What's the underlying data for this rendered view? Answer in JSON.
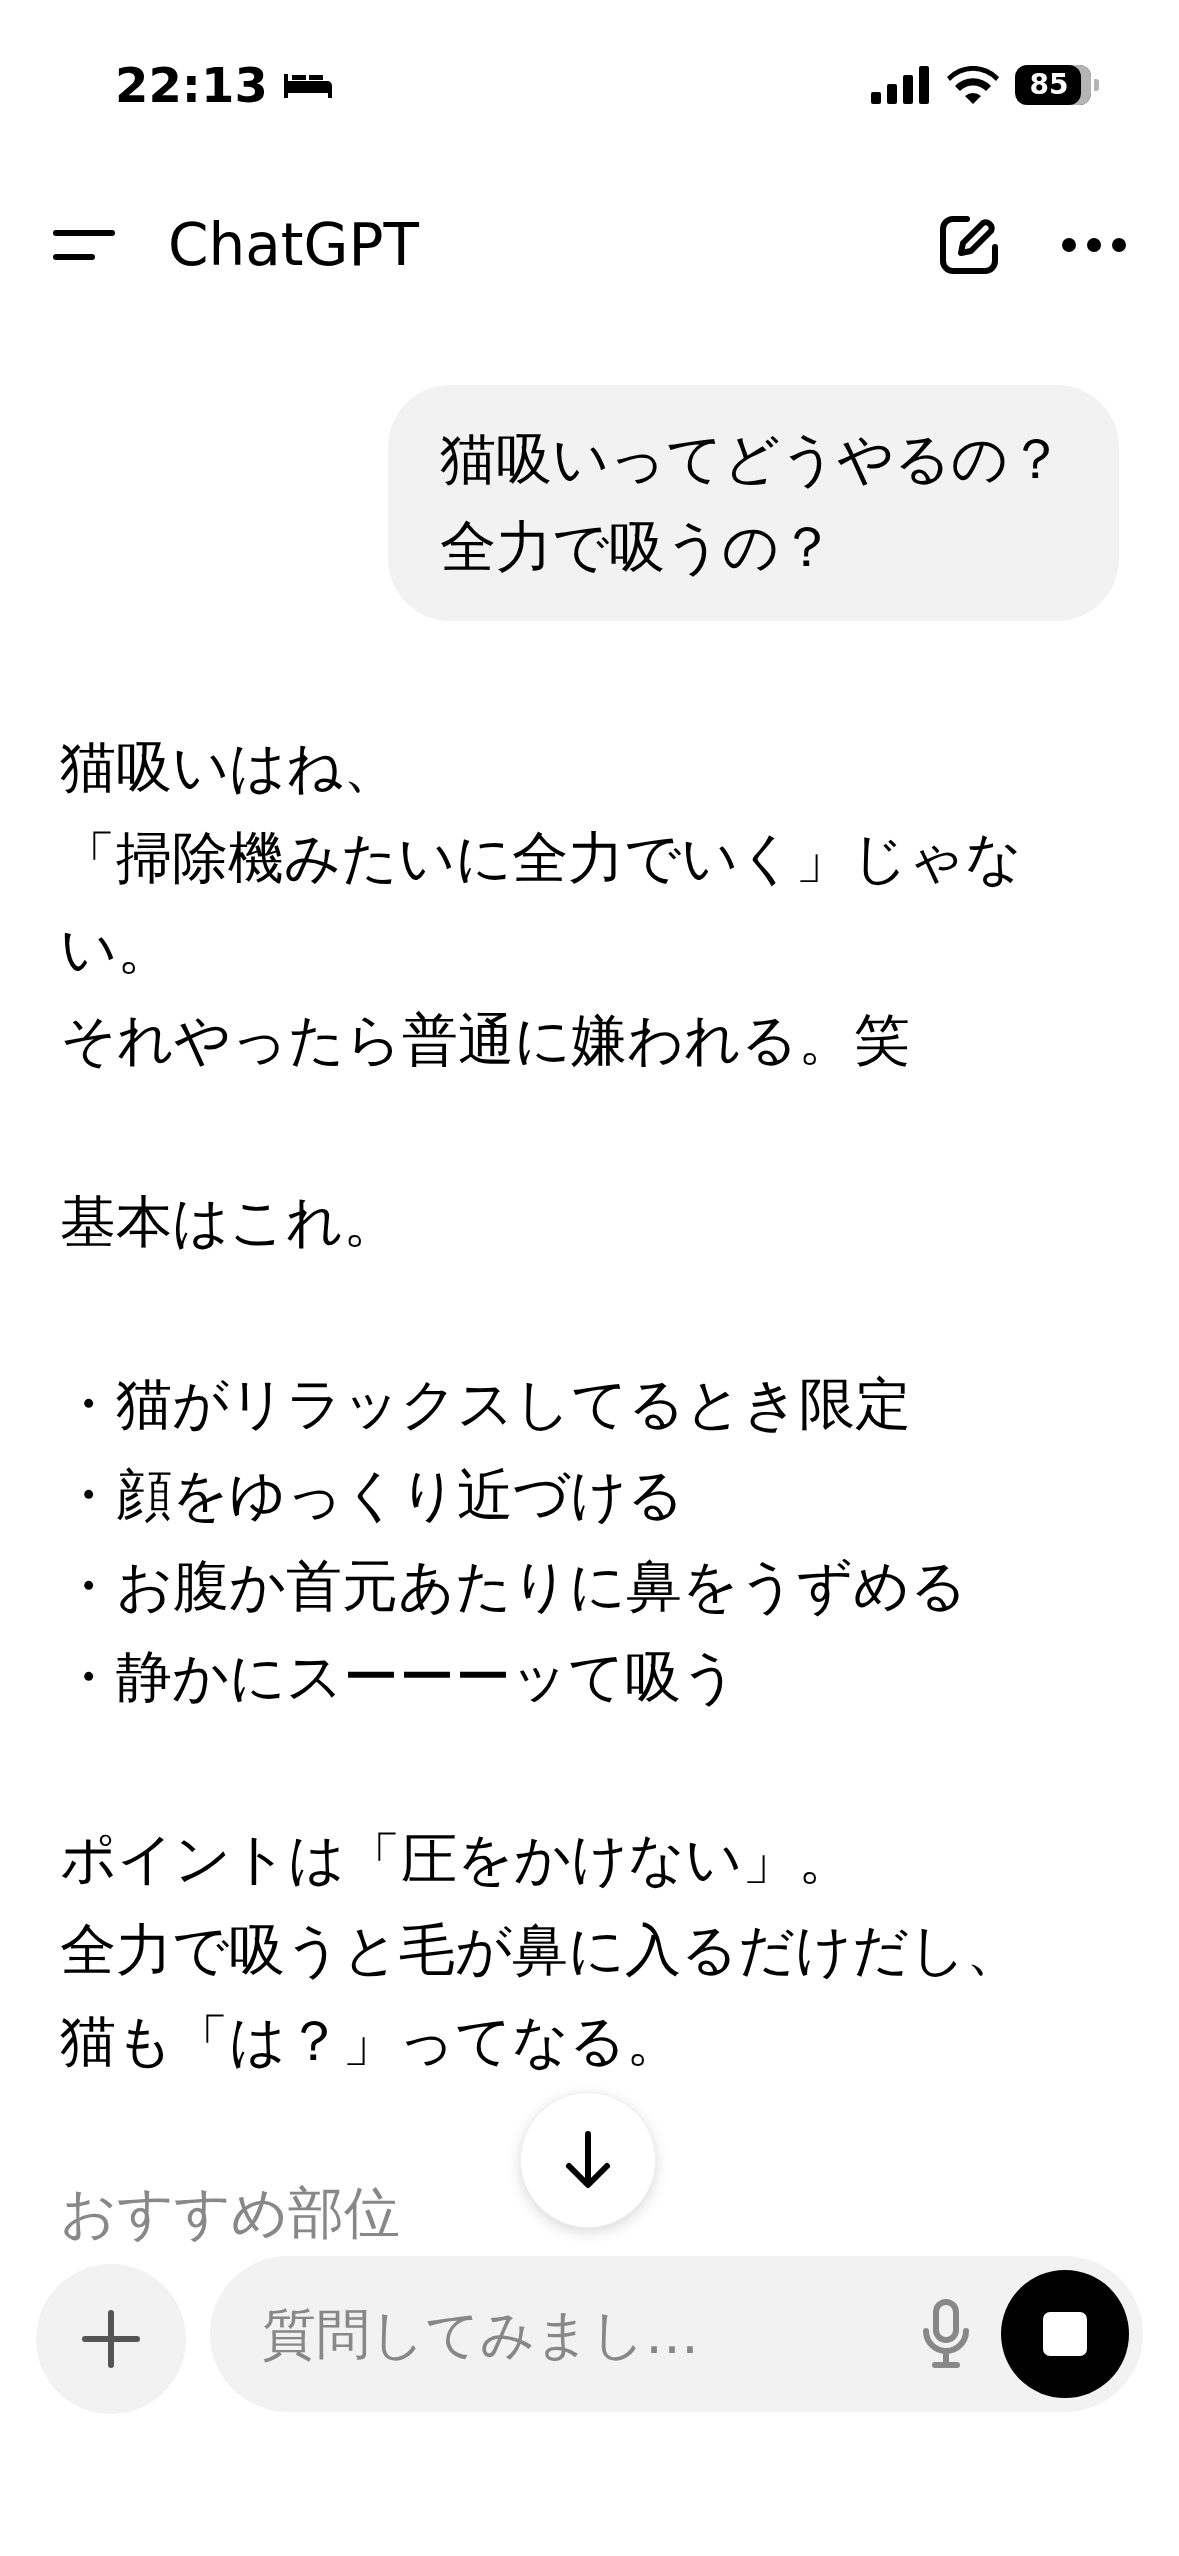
{
  "status_bar": {
    "time": "22:13",
    "battery": "85"
  },
  "header": {
    "title": "ChatGPT"
  },
  "user_message": {
    "text": "猫吸いってどうやるの？全力で吸うの？"
  },
  "assistant_message": {
    "paragraphs": [
      [
        "猫吸いはね、",
        "「掃除機みたいに全力でいく」じゃない。",
        "それやったら普通に嫌われる。笑"
      ],
      [
        "基本はこれ。"
      ],
      [
        "・猫がリラックスしてるとき限定",
        "・顔をゆっくり近づける",
        "・お腹か首元あたりに鼻をうずめる",
        "・静かにスーーーッて吸う"
      ],
      [
        "ポイントは「圧をかけない」。",
        "全力で吸うと毛が鼻に入るだけだし、猫も「は？」ってなる。"
      ]
    ],
    "faded_heading": "おすすめ部位"
  },
  "composer": {
    "placeholder": "質問してみまし…"
  }
}
